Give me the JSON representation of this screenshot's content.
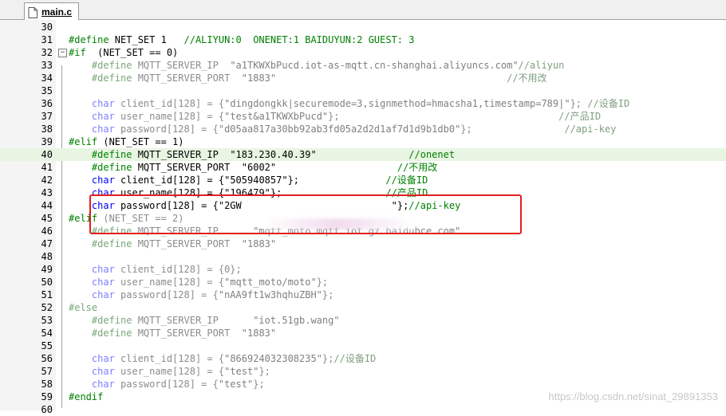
{
  "tab": {
    "filename": "main.c",
    "icon": "c-file-icon"
  },
  "lines": [
    {
      "n": "30",
      "parts": []
    },
    {
      "n": "31",
      "parts": [
        [
          "kw-pre",
          "#define"
        ],
        [
          "",
          " NET_SET 1   "
        ],
        [
          "cmt",
          "//ALIYUN:0  ONENET:1 BAIDUYUN:2 GUEST: 3"
        ]
      ]
    },
    {
      "n": "32",
      "fold": true,
      "parts": [
        [
          "kw-pre",
          "#if"
        ],
        [
          "",
          "  (NET_SET == 0)"
        ]
      ]
    },
    {
      "n": "33",
      "parts": [
        [
          "",
          "    "
        ],
        [
          "kw-pre-dim",
          "#define"
        ],
        [
          "dim",
          " MQTT_SERVER_IP  "
        ],
        [
          "str",
          "\"a1TKWXbPucd.iot-as-mqtt.cn-shanghai.aliyuncs.com\""
        ],
        [
          "cmt-dim",
          "//aliyun"
        ]
      ]
    },
    {
      "n": "34",
      "parts": [
        [
          "",
          "    "
        ],
        [
          "kw-pre-dim",
          "#define"
        ],
        [
          "dim",
          " MQTT_SERVER_PORT  "
        ],
        [
          "str",
          "\"1883\""
        ],
        [
          "",
          "                                        "
        ],
        [
          "cmt-dim",
          "//不用改"
        ]
      ]
    },
    {
      "n": "35",
      "parts": []
    },
    {
      "n": "36",
      "parts": [
        [
          "",
          "    "
        ],
        [
          "type-dim",
          "char"
        ],
        [
          "dim",
          " client_id[128] = {"
        ],
        [
          "str",
          "\"dingdongkk|securemode=3,signmethod=hmacsha1,timestamp=789|\""
        ],
        [
          "dim",
          "}; "
        ],
        [
          "cmt-dim",
          "//设备ID"
        ]
      ]
    },
    {
      "n": "37",
      "parts": [
        [
          "",
          "    "
        ],
        [
          "type-dim",
          "char"
        ],
        [
          "dim",
          " user_name[128] = {"
        ],
        [
          "str",
          "\"test&a1TKWXbPucd\""
        ],
        [
          "dim",
          "};"
        ],
        [
          "",
          "                                      "
        ],
        [
          "cmt-dim",
          "//产品ID"
        ]
      ]
    },
    {
      "n": "38",
      "parts": [
        [
          "",
          "    "
        ],
        [
          "type-dim",
          "char"
        ],
        [
          "dim",
          " password[128] = {"
        ],
        [
          "str",
          "\"d05aa817a30bb92ab3fd05a2d2d1af7d1d9b1db0\""
        ],
        [
          "dim",
          "};"
        ],
        [
          "",
          "                "
        ],
        [
          "cmt-dim",
          "//api-key"
        ]
      ]
    },
    {
      "n": "39",
      "parts": [
        [
          "kw-pre",
          "#elif"
        ],
        [
          "",
          " (NET_SET == 1)"
        ]
      ]
    },
    {
      "n": "40",
      "hl": true,
      "parts": [
        [
          "",
          "    "
        ],
        [
          "kw-pre",
          "#define"
        ],
        [
          "",
          " MQTT_SERVER_IP  "
        ],
        [
          "str-dk",
          "\"183.230.40.39\""
        ],
        [
          "",
          "                "
        ],
        [
          "cmt",
          "//onenet"
        ]
      ]
    },
    {
      "n": "41",
      "parts": [
        [
          "",
          "    "
        ],
        [
          "kw-pre",
          "#define"
        ],
        [
          "",
          " MQTT_SERVER_PORT  "
        ],
        [
          "str-dk",
          "\"6002\""
        ],
        [
          "",
          "                     "
        ],
        [
          "cmt",
          "//不用改"
        ]
      ]
    },
    {
      "n": "42",
      "parts": [
        [
          "",
          "    "
        ],
        [
          "type",
          "char"
        ],
        [
          "",
          " client_id[128] = {"
        ],
        [
          "str-dk",
          "\"505940857\""
        ],
        [
          "",
          "};"
        ],
        [
          "",
          "               "
        ],
        [
          "cmt",
          "//设备ID"
        ]
      ]
    },
    {
      "n": "43",
      "parts": [
        [
          "",
          "    "
        ],
        [
          "type",
          "char"
        ],
        [
          "",
          " user_name[128] = {"
        ],
        [
          "str-dk",
          "\"196479\""
        ],
        [
          "",
          "};"
        ],
        [
          "",
          "                  "
        ],
        [
          "cmt",
          "//产品ID"
        ]
      ]
    },
    {
      "n": "44",
      "parts": [
        [
          "",
          "    "
        ],
        [
          "type",
          "char"
        ],
        [
          "",
          " password[128] = {"
        ],
        [
          "str-dk",
          "\"2GW"
        ],
        [
          "",
          "                          "
        ],
        [
          "str-dk",
          "\""
        ],
        [
          "",
          "};"
        ],
        [
          "cmt",
          "//api-key"
        ]
      ]
    },
    {
      "n": "45",
      "parts": [
        [
          "kw-pre",
          "#elif"
        ],
        [
          "dim",
          " (NET_SET == 2)"
        ]
      ]
    },
    {
      "n": "46",
      "parts": [
        [
          "",
          "    "
        ],
        [
          "kw-pre-dim",
          "#define"
        ],
        [
          "dim",
          " MQTT_SERVER_IP      "
        ],
        [
          "str",
          "\"mqtt_moto.mqtt.iot.gz.baidubce.com\""
        ]
      ]
    },
    {
      "n": "47",
      "parts": [
        [
          "",
          "    "
        ],
        [
          "kw-pre-dim",
          "#define"
        ],
        [
          "dim",
          " MQTT_SERVER_PORT  "
        ],
        [
          "str",
          "\"1883\""
        ]
      ]
    },
    {
      "n": "48",
      "parts": []
    },
    {
      "n": "49",
      "parts": [
        [
          "",
          "    "
        ],
        [
          "type-dim",
          "char"
        ],
        [
          "dim",
          " client_id[128] = {0};"
        ]
      ]
    },
    {
      "n": "50",
      "parts": [
        [
          "",
          "    "
        ],
        [
          "type-dim",
          "char"
        ],
        [
          "dim",
          " user_name[128] = {"
        ],
        [
          "str",
          "\"mqtt_moto/moto\""
        ],
        [
          "dim",
          "};"
        ]
      ]
    },
    {
      "n": "51",
      "parts": [
        [
          "",
          "    "
        ],
        [
          "type-dim",
          "char"
        ],
        [
          "dim",
          " password[128] = {"
        ],
        [
          "str",
          "\"nAA9ft1w3hqhuZBH\""
        ],
        [
          "dim",
          "};"
        ]
      ]
    },
    {
      "n": "52",
      "parts": [
        [
          "kw-pre-dim",
          "#else"
        ]
      ]
    },
    {
      "n": "53",
      "parts": [
        [
          "",
          "    "
        ],
        [
          "kw-pre-dim",
          "#define"
        ],
        [
          "dim",
          " MQTT_SERVER_IP      "
        ],
        [
          "str",
          "\"iot.51gb.wang\""
        ]
      ]
    },
    {
      "n": "54",
      "parts": [
        [
          "",
          "    "
        ],
        [
          "kw-pre-dim",
          "#define"
        ],
        [
          "dim",
          " MQTT_SERVER_PORT  "
        ],
        [
          "str",
          "\"1883\""
        ]
      ]
    },
    {
      "n": "55",
      "parts": []
    },
    {
      "n": "56",
      "parts": [
        [
          "",
          "    "
        ],
        [
          "type-dim",
          "char"
        ],
        [
          "dim",
          " client_id[128] = {"
        ],
        [
          "str",
          "\"866924032308235\""
        ],
        [
          "dim",
          "};"
        ],
        [
          "cmt-dim",
          "//设备ID"
        ]
      ]
    },
    {
      "n": "57",
      "parts": [
        [
          "",
          "    "
        ],
        [
          "type-dim",
          "char"
        ],
        [
          "dim",
          " user_name[128] = {"
        ],
        [
          "str",
          "\"test\""
        ],
        [
          "dim",
          "};"
        ]
      ]
    },
    {
      "n": "58",
      "parts": [
        [
          "",
          "    "
        ],
        [
          "type-dim",
          "char"
        ],
        [
          "dim",
          " password[128] = {"
        ],
        [
          "str",
          "\"test\""
        ],
        [
          "dim",
          "};"
        ]
      ]
    },
    {
      "n": "59",
      "parts": [
        [
          "kw-pre",
          "#endif"
        ]
      ]
    },
    {
      "n": "60",
      "parts": []
    }
  ],
  "watermark": "https://blog.csdn.net/sinat_29891353"
}
